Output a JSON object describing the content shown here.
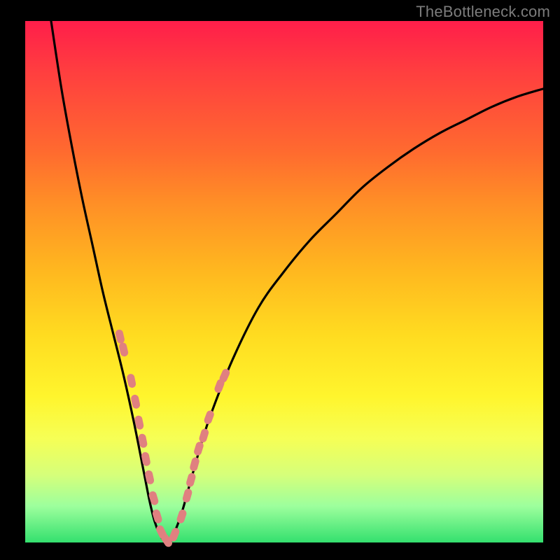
{
  "watermark": "TheBottleneck.com",
  "colors": {
    "background_frame": "#000000",
    "gradient_top": "#ff1e4a",
    "gradient_bottom": "#34e06e",
    "curve_stroke": "#000000",
    "marker_fill": "#e08080",
    "watermark_text": "#7c7c7c"
  },
  "chart_data": {
    "type": "line",
    "title": "",
    "subtitle": "",
    "xlabel": "",
    "ylabel": "",
    "xlim": [
      0,
      100
    ],
    "ylim": [
      0,
      100
    ],
    "grid": false,
    "legend_position": "none",
    "annotations": [
      {
        "text": "TheBottleneck.com",
        "position": "top-right"
      }
    ],
    "series": [
      {
        "name": "left-branch",
        "x": [
          5,
          7,
          9,
          11,
          13,
          15,
          17,
          19,
          21,
          23,
          24,
          25,
          26,
          27
        ],
        "values": [
          100,
          87,
          76,
          66,
          57,
          48,
          40,
          32,
          23,
          13,
          8,
          4,
          1.5,
          0
        ]
      },
      {
        "name": "right-branch",
        "x": [
          28,
          30,
          32,
          34,
          36,
          40,
          45,
          50,
          55,
          60,
          65,
          70,
          75,
          80,
          85,
          90,
          95,
          100
        ],
        "values": [
          0,
          5,
          12,
          19,
          25,
          35,
          45,
          52,
          58,
          63,
          68,
          72,
          75.5,
          78.5,
          81,
          83.5,
          85.5,
          87
        ]
      }
    ],
    "markers": {
      "name": "sample-points",
      "shape": "rounded-pill",
      "color": "#e08080",
      "points": [
        {
          "x": 18.3,
          "y": 39.5
        },
        {
          "x": 19.0,
          "y": 37.0
        },
        {
          "x": 20.5,
          "y": 31.0
        },
        {
          "x": 21.3,
          "y": 27.0
        },
        {
          "x": 22.0,
          "y": 23.0
        },
        {
          "x": 22.7,
          "y": 19.5
        },
        {
          "x": 23.3,
          "y": 16.0
        },
        {
          "x": 24.0,
          "y": 12.5
        },
        {
          "x": 24.8,
          "y": 8.5
        },
        {
          "x": 25.5,
          "y": 5.0
        },
        {
          "x": 26.3,
          "y": 2.0
        },
        {
          "x": 27.3,
          "y": 0.4
        },
        {
          "x": 28.8,
          "y": 1.5
        },
        {
          "x": 30.2,
          "y": 5.0
        },
        {
          "x": 31.3,
          "y": 9.0
        },
        {
          "x": 32.0,
          "y": 12.0
        },
        {
          "x": 32.7,
          "y": 15.0
        },
        {
          "x": 33.5,
          "y": 18.0
        },
        {
          "x": 34.5,
          "y": 20.5
        },
        {
          "x": 35.5,
          "y": 24.0
        },
        {
          "x": 37.5,
          "y": 30.0
        },
        {
          "x": 38.5,
          "y": 32.0
        }
      ],
      "note": "x is percent of horizontal extent (0=left,100=right); y is percent of vertical extent (0=bottom,100=top). Values estimated from pixel positions."
    },
    "background_encoding": "vertical color gradient from red (top, high mismatch) to green (bottom, optimal)"
  }
}
